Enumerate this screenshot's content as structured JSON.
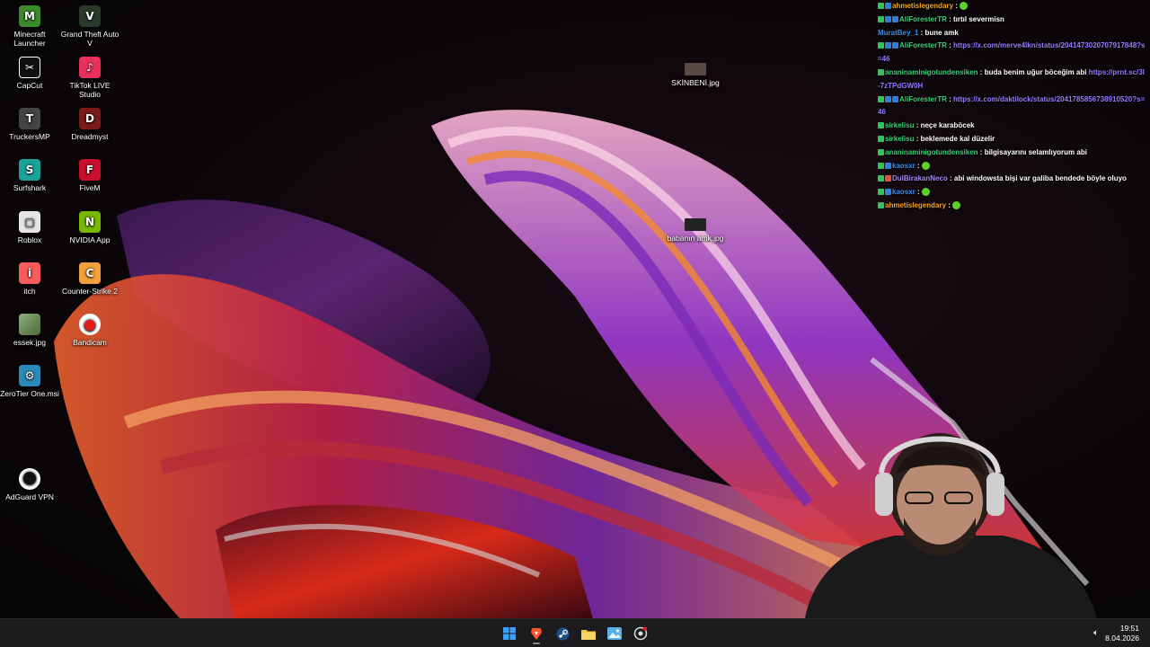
{
  "desktop_icons": [
    {
      "label": "Minecraft Launcher",
      "icon": "minecraft-icon",
      "color": "#3a8a2a",
      "letter": "M"
    },
    {
      "label": "Grand Theft Auto V",
      "icon": "gta-icon",
      "color": "#2b3a2a",
      "letter": "V"
    },
    {
      "label": "CapCut",
      "icon": "capcut-icon",
      "color": "#111111",
      "letter": "✂"
    },
    {
      "label": "TikTok LIVE Studio",
      "icon": "tiktok-live-icon",
      "color": "#e8315a",
      "letter": "♪"
    },
    {
      "label": "TruckersMP",
      "icon": "truckersmp-icon",
      "color": "#444444",
      "letter": "T"
    },
    {
      "label": "Dreadmyst",
      "icon": "dreadmyst-icon",
      "color": "#7a1a1a",
      "letter": "D"
    },
    {
      "label": "Surfshark",
      "icon": "surfshark-icon",
      "color": "#1aa39a",
      "letter": "S"
    },
    {
      "label": "FiveM",
      "icon": "fivem-icon",
      "color": "#c8102e",
      "letter": "F"
    },
    {
      "label": "Roblox",
      "icon": "roblox-icon",
      "color": "#e6e6e6",
      "letter": "▢"
    },
    {
      "label": "NVIDIA App",
      "icon": "nvidia-icon",
      "color": "#76b900",
      "letter": "N"
    },
    {
      "label": "itch",
      "icon": "itch-icon",
      "color": "#fa5c5c",
      "letter": "i"
    },
    {
      "label": "Counter-Strike 2",
      "icon": "counter-strike-icon",
      "color": "#f2a23a",
      "letter": "C"
    },
    {
      "label": "essek.jpg",
      "icon": "image-file-icon",
      "color": "#6b8f5a",
      "letter": ""
    },
    {
      "label": "Bandicam",
      "icon": "bandicam-icon",
      "color": "#e11b1b",
      "letter": "●"
    },
    {
      "label": "ZeroTier One.msi",
      "icon": "installer-icon",
      "color": "#2a8ab8",
      "letter": "⚙"
    },
    {
      "label": "AdGuard VPN",
      "icon": "adguard-vpn-icon",
      "color": "#ffffff",
      "letter": "☻"
    },
    {
      "label": "SKİNBENİ.jpg",
      "icon": "image-file-icon",
      "color": "#5a4a44",
      "letter": ""
    },
    {
      "label": "babanın amk.jpg",
      "icon": "image-file-icon",
      "color": "#222222",
      "letter": ""
    }
  ],
  "chat": [
    {
      "user": "ahmetislegendary",
      "color": "#f5a623",
      "badges": [
        "mod",
        "sub"
      ],
      "text": "",
      "emote": true
    },
    {
      "user": "AliForesterTR",
      "color": "#3bd17a",
      "badges": [
        "mod",
        "sub",
        "sub"
      ],
      "text": "tırtıl severmisn",
      "emote": false
    },
    {
      "user": "MuratBey_1",
      "color": "#3f8fe8",
      "badges": [],
      "text": "bune amk",
      "emote": false
    },
    {
      "user": "AliForesterTR",
      "color": "#3bd17a",
      "badges": [
        "mod",
        "sub",
        "sub"
      ],
      "text": "",
      "link": "https://x.com/merve4lkn/status/2041473020707917848?s=46",
      "emote": false
    },
    {
      "user": "ananinaminigotundensiken",
      "color": "#3bd17a",
      "badges": [
        "mod"
      ],
      "text": "buda benim uğur böceğim abi",
      "link": "https://prnt.sc/3I-7zTPdGW0H",
      "emote": false
    },
    {
      "user": "AliForesterTR",
      "color": "#3bd17a",
      "badges": [
        "mod",
        "sub",
        "sub"
      ],
      "text": "",
      "link": "https://x.com/daktilock/status/2041785856738910520?s=46",
      "emote": false
    },
    {
      "user": "sirkelisu",
      "color": "#3bd17a",
      "badges": [
        "mod"
      ],
      "text": "neçe karaböcek",
      "emote": false
    },
    {
      "user": "sirkelisu",
      "color": "#3bd17a",
      "badges": [
        "mod"
      ],
      "text": "beklemede kal düzelir",
      "emote": false
    },
    {
      "user": "ananinaminigotundensiken",
      "color": "#3bd17a",
      "badges": [
        "mod"
      ],
      "text": "bilgisayarını selamlıyorum abi",
      "emote": false
    },
    {
      "user": "kaosxr",
      "color": "#3f8fe8",
      "badges": [
        "mod",
        "sub"
      ],
      "text": "",
      "emote": true
    },
    {
      "user": "DulBirakanNeco",
      "color": "#a58af0",
      "badges": [
        "mod",
        "other"
      ],
      "text": "abi windowsta bişi var galiba bendede böyle oluyo",
      "emote": false
    },
    {
      "user": "kaosxr",
      "color": "#3f8fe8",
      "badges": [
        "mod",
        "sub"
      ],
      "text": "",
      "emote": true
    },
    {
      "user": "ahmetislegendary",
      "color": "#f5a623",
      "badges": [
        "mod"
      ],
      "text": "",
      "emote": true
    }
  ],
  "taskbar": {
    "apps": [
      {
        "name": "start-button",
        "icon": "windows-icon",
        "color": "#3aa0ff"
      },
      {
        "name": "taskbar-brave",
        "icon": "brave-icon",
        "color": "#fb542b",
        "active": true
      },
      {
        "name": "taskbar-steam",
        "icon": "steam-icon",
        "color": "#c6d4df"
      },
      {
        "name": "taskbar-file-explorer",
        "icon": "folder-icon",
        "color": "#f4c542"
      },
      {
        "name": "taskbar-photos",
        "icon": "photos-icon",
        "color": "#5ab0e8"
      },
      {
        "name": "taskbar-obs",
        "icon": "record-icon",
        "color": "#dddddd"
      }
    ],
    "time": "19:51",
    "date": "8.04.2026",
    "volume_icon": "speaker-icon"
  }
}
